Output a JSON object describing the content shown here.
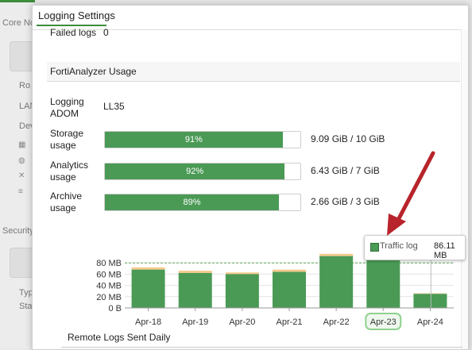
{
  "background": {
    "core_label": "Core No",
    "items": [
      "Ro",
      "LAN",
      "Dev",
      "Security",
      "Typ",
      "Sta"
    ]
  },
  "dialog": {
    "title": "Logging Settings",
    "failed_logs_label": "Failed logs",
    "failed_logs_value": "0",
    "section_title": "FortiAnalyzer Usage",
    "adom_label": "Logging ADOM",
    "adom_value": "LL35",
    "usage": [
      {
        "label": "Storage usage",
        "percent_text": "91%",
        "fraction": 0.91,
        "amount": "9.09 GiB / 10 GiB"
      },
      {
        "label": "Analytics usage",
        "percent_text": "92%",
        "fraction": 0.92,
        "amount": "6.43 GiB / 7 GiB"
      },
      {
        "label": "Archive usage",
        "percent_text": "89%",
        "fraction": 0.89,
        "amount": "2.66 GiB / 3 GiB"
      }
    ],
    "remote_logs_title": "Remote Logs Sent Daily"
  },
  "tooltip": {
    "series": "Traffic log",
    "value": "86.11 MB"
  },
  "chart_data": {
    "type": "bar",
    "categories": [
      "Apr-18",
      "Apr-19",
      "Apr-20",
      "Apr-21",
      "Apr-22",
      "Apr-23",
      "Apr-24"
    ],
    "series": [
      {
        "name": "Traffic log",
        "values": [
          68,
          62,
          60,
          64,
          92,
          86.11,
          25
        ]
      },
      {
        "values": [
          4,
          4,
          3,
          4,
          4,
          4,
          1
        ]
      }
    ],
    "yticks": [
      "0 B",
      "20 MB",
      "40 MB",
      "60 MB",
      "80 MB"
    ],
    "ylim": [
      0,
      100
    ],
    "threshold": 80,
    "highlighted_category": "Apr-23",
    "colors": {
      "traffic": "#4a9a56",
      "other": "#f5c98a",
      "threshold": "#5aa55a"
    }
  },
  "colors": {
    "accent": "#3c8d3c",
    "bar": "#4a9a56"
  }
}
